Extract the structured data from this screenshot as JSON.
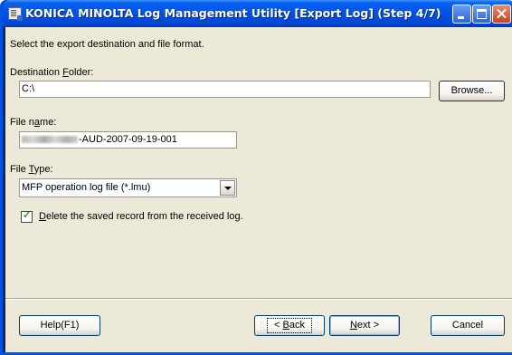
{
  "window": {
    "title": "KONICA MINOLTA Log Management Utility [Export Log] (Step 4/7)"
  },
  "instruction": "Select the export destination and file format.",
  "destination": {
    "label_pre": "Destination ",
    "label_key": "F",
    "label_post": "older:",
    "value": "C:\\",
    "browse_label": "Browse..."
  },
  "file_name": {
    "label_pre": "File n",
    "label_key": "a",
    "label_post": "me:",
    "value_visible": "-AUD-2007-09-19-001"
  },
  "file_type": {
    "label_pre": "File ",
    "label_key": "T",
    "label_post": "ype:",
    "selected": "MFP operation log file (*.lmu)"
  },
  "delete_record": {
    "checked": true,
    "label_pre": "",
    "label_key": "D",
    "label_post": "elete the saved record from the received log."
  },
  "buttons": {
    "help": "Help(F1)",
    "back_pre": "< ",
    "back_key": "B",
    "back_post": "ack",
    "next_key": "N",
    "next_post": "ext >",
    "cancel": "Cancel"
  },
  "colors": {
    "titlebar": "#0052e5",
    "dialog_bg": "#ece9d8",
    "close_button": "#c8421c"
  }
}
